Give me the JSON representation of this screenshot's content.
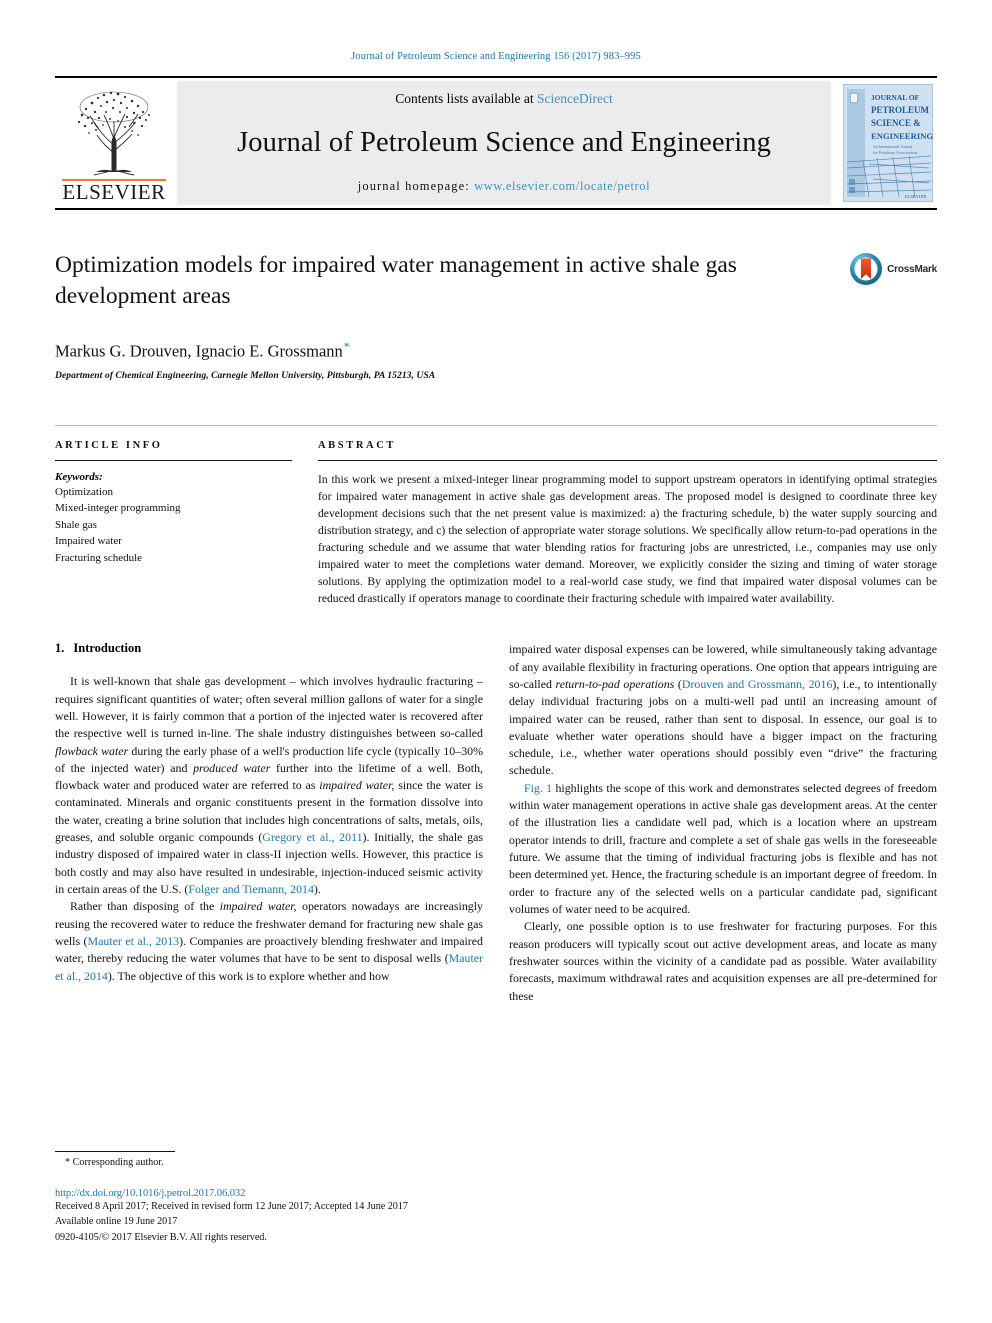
{
  "running_head": "Journal of Petroleum Science and Engineering 156 (2017) 983–995",
  "masthead": {
    "publisher_name": "ELSEVIER",
    "contents_prefix": "Contents lists available at ",
    "contents_link": "ScienceDirect",
    "journal_title": "Journal of Petroleum Science and Engineering",
    "homepage_prefix": "journal homepage: ",
    "homepage_url": "www.elsevier.com/locate/petrol",
    "cover_title_lines": [
      "JOURNAL OF",
      "PETROLEUM",
      "SCIENCE &",
      "ENGINEERING"
    ],
    "accent_orange": "#f47c20",
    "link_blue": "#3f8fc4",
    "cover_blue": "#2f6fae"
  },
  "article": {
    "title": "Optimization models for impaired water management in active shale gas development areas",
    "authors": "Markus G. Drouven, Ignacio E. Grossmann",
    "corresponding_marker": "*",
    "affiliation": "Department of Chemical Engineering, Carnegie Mellon University, Pittsburgh, PA 15213, USA",
    "crossmark_label": "CrossMark"
  },
  "article_info": {
    "heading": "ARTICLE INFO",
    "keywords_label": "Keywords:",
    "keywords": [
      "Optimization",
      "Mixed-integer programming",
      "Shale gas",
      "Impaired water",
      "Fracturing schedule"
    ]
  },
  "abstract": {
    "heading": "ABSTRACT",
    "text": "In this work we present a mixed-integer linear programming model to support upstream operators in identifying optimal strategies for impaired water management in active shale gas development areas. The proposed model is designed to coordinate three key development decisions such that the net present value is maximized: a) the fracturing schedule, b) the water supply sourcing and distribution strategy, and c) the selection of appropriate water storage solutions. We specifically allow return-to-pad operations in the fracturing schedule and we assume that water blending ratios for fracturing jobs are unrestricted, i.e., companies may use only impaired water to meet the completions water demand. Moreover, we explicitly consider the sizing and timing of water storage solutions. By applying the optimization model to a real-world case study, we find that impaired water disposal volumes can be reduced drastically if operators manage to coordinate their fracturing schedule with impaired water availability."
  },
  "introduction": {
    "number": "1.",
    "heading": "Introduction",
    "left_paragraphs": [
      "It is well-known that shale gas development – which involves hydraulic fracturing – requires significant quantities of water; often several million gallons of water for a single well. However, it is fairly common that a portion of the injected water is recovered after the respective well is turned in-line. The shale industry distinguishes between so-called flowback water during the early phase of a well's production life cycle (typically 10–30% of the injected water) and produced water further into the lifetime of a well. Both, flowback water and produced water are referred to as impaired water, since the water is contaminated. Minerals and organic constituents present in the formation dissolve into the water, creating a brine solution that includes high concentrations of salts, metals, oils, greases, and soluble organic compounds (Gregory et al., 2011). Initially, the shale gas industry disposed of impaired water in class-II injection wells. However, this practice is both costly and may also have resulted in undesirable, injection-induced seismic activity in certain areas of the U.S. (Folger and Tiemann, 2014).",
      "Rather than disposing of the impaired water, operators nowadays are increasingly reusing the recovered water to reduce the freshwater demand for fracturing new shale gas wells (Mauter et al., 2013). Companies are proactively blending freshwater and impaired water, thereby reducing the water volumes that have to be sent to disposal wells (Mauter et al., 2014). The objective of this work is to explore whether and how"
    ],
    "right_paragraphs": [
      "impaired water disposal expenses can be lowered, while simultaneously taking advantage of any available flexibility in fracturing operations. One option that appears intriguing are so-called return-to-pad operations (Drouven and Grossmann, 2016), i.e., to intentionally delay individual fracturing jobs on a multi-well pad until an increasing amount of impaired water can be reused, rather than sent to disposal. In essence, our goal is to evaluate whether water operations should have a bigger impact on the fracturing schedule, i.e., whether water operations should possibly even “drive” the fracturing schedule.",
      "Fig. 1 highlights the scope of this work and demonstrates selected degrees of freedom within water management operations in active shale gas development areas. At the center of the illustration lies a candidate well pad, which is a location where an upstream operator intends to drill, fracture and complete a set of shale gas wells in the foreseeable future. We assume that the timing of individual fracturing jobs is flexible and has not been determined yet. Hence, the fracturing schedule is an important degree of freedom. In order to fracture any of the selected wells on a particular candidate pad, significant volumes of water need to be acquired.",
      "Clearly, one possible option is to use freshwater for fracturing purposes. For this reason producers will typically scout out active development areas, and locate as many freshwater sources within the vicinity of a candidate pad as possible. Water availability forecasts, maximum withdrawal rates and acquisition expenses are all pre-determined for these"
    ],
    "citations": [
      "Gregory et al., 2011",
      "Folger and Tiemann, 2014",
      "Mauter et al., 2013",
      "Mauter et al., 2014",
      "Drouven and Grossmann, 2016",
      "Fig. 1"
    ]
  },
  "footer": {
    "corresponding_author": "* Corresponding author.",
    "doi": "http://dx.doi.org/10.1016/j.petrol.2017.06.032",
    "dates": "Received 8 April 2017; Received in revised form 12 June 2017; Accepted 14 June 2017",
    "available_online": "Available online 19 June 2017",
    "copyright": "0920-4105/© 2017 Elsevier B.V. All rights reserved."
  }
}
